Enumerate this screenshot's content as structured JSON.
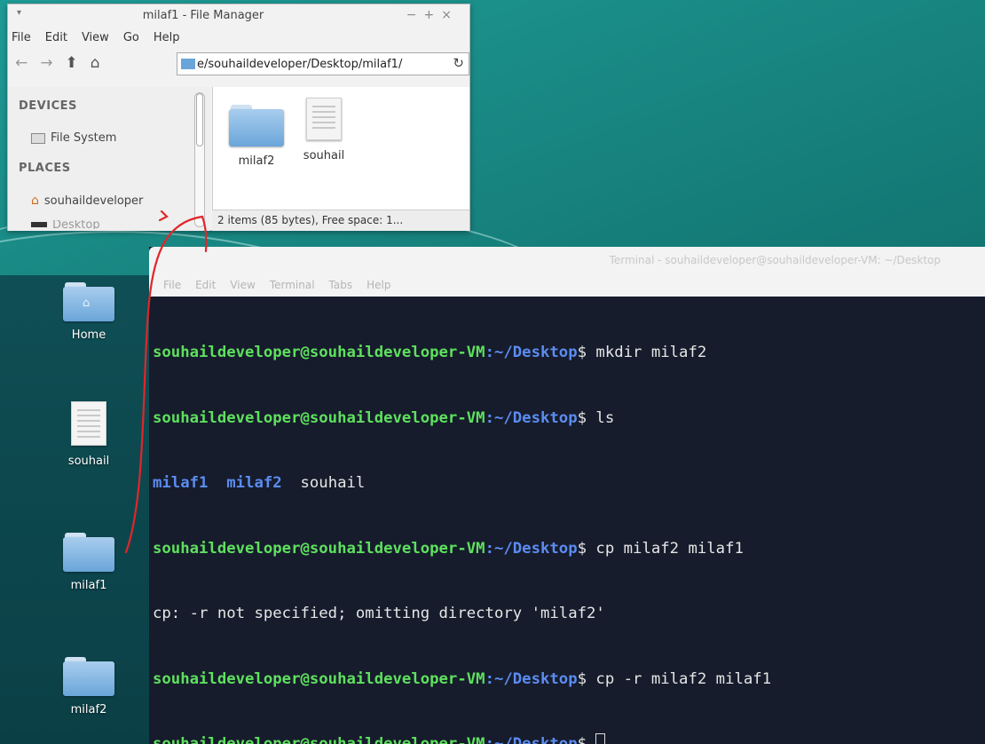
{
  "file_manager": {
    "title": "milaf1 - File Manager",
    "menu": [
      "File",
      "Edit",
      "View",
      "Go",
      "Help"
    ],
    "path": "e/souhaildeveloper/Desktop/milaf1/",
    "sidebar": {
      "devices_header": "DEVICES",
      "file_system": "File System",
      "places_header": "PLACES",
      "home": "souhaildeveloper",
      "desktop_partial": "Desktop"
    },
    "files": [
      {
        "name": "milaf2",
        "icon": "folder-icon"
      },
      {
        "name": "souhail",
        "icon": "document-icon"
      }
    ],
    "status": "2 items (85 bytes), Free space: 1..."
  },
  "desktop": {
    "icons": [
      {
        "label": "Home",
        "icon": "home-folder-icon"
      },
      {
        "label": "souhail",
        "icon": "document-icon"
      },
      {
        "label": "milaf1",
        "icon": "folder-icon"
      },
      {
        "label": "milaf2",
        "icon": "folder-icon"
      }
    ]
  },
  "terminal": {
    "title": "Terminal - souhaildeveloper@souhaildeveloper-VM: ~/Desktop",
    "menu": [
      "File",
      "Edit",
      "View",
      "Terminal",
      "Tabs",
      "Help"
    ],
    "user_host": "souhaildeveloper@souhaildeveloper-VM",
    "cwd": "~/Desktop",
    "lines": [
      {
        "cmd": "mkdir milaf2"
      },
      {
        "cmd": "ls"
      },
      {
        "ls_dir1": "milaf1",
        "ls_dir2": "milaf2",
        "ls_file": "souhail"
      },
      {
        "cmd": "cp milaf2 milaf1"
      },
      {
        "output": "cp: -r not specified; omitting directory 'milaf2'"
      },
      {
        "cmd": "cp -r milaf2 milaf1"
      },
      {
        "cmd": ""
      }
    ]
  },
  "colors": {
    "desktop_teal": "#1a8a86",
    "terminal_bg": "#161c2c",
    "prompt_green": "#5ee05e",
    "prompt_blue": "#5c8cf0",
    "annotation_red": "#e0262b"
  }
}
